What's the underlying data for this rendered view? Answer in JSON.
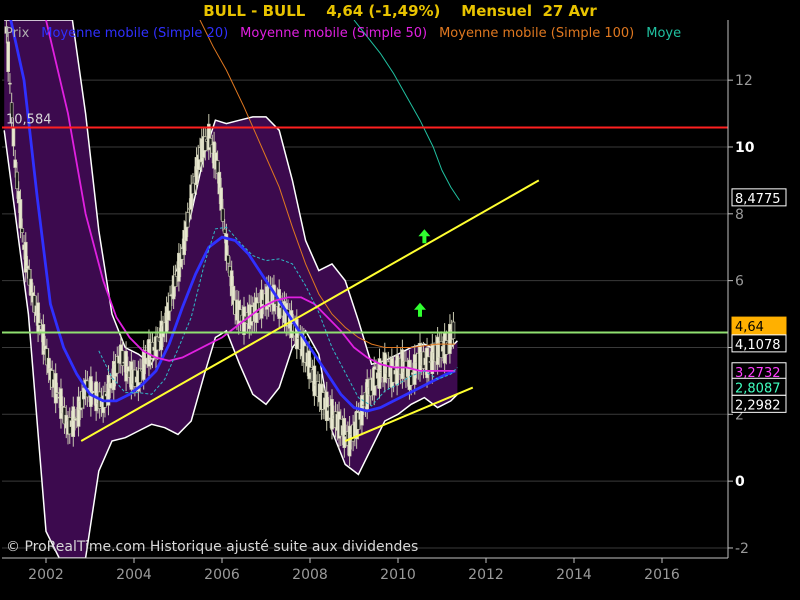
{
  "header": {
    "title": "BULL - BULL    4,64 (-1,49%)    Mensuel  27 Avr"
  },
  "legend": [
    {
      "label": "Prix",
      "color": "#b0b0b0"
    },
    {
      "label": "Moyenne mobile (Simple 20)",
      "color": "#3030ff"
    },
    {
      "label": "Moyenne mobile (Simple 50)",
      "color": "#e020e0"
    },
    {
      "label": "Moyenne mobile (Simple 100)",
      "color": "#e07820"
    },
    {
      "label": "Moye",
      "color": "#20c0a0"
    }
  ],
  "copyright": "© ProRealTime.com Historique ajusté suite aux dividendes",
  "chart_data": {
    "type": "line",
    "xlim": [
      2001,
      2017.5
    ],
    "ylim": [
      -2.3,
      13.8
    ],
    "x_ticks": [
      "2002",
      "2004",
      "2006",
      "2008",
      "2010",
      "2012",
      "2014",
      "2016"
    ],
    "y_ticks": [
      {
        "value": -2,
        "label": "-2",
        "strong": false
      },
      {
        "value": 0,
        "label": "0",
        "strong": true
      },
      {
        "value": 2,
        "label": "2",
        "strong": false
      },
      {
        "value": 4,
        "label": "4",
        "strong": false
      },
      {
        "value": 6,
        "label": "6",
        "strong": false
      },
      {
        "value": 8,
        "label": "8",
        "strong": false
      },
      {
        "value": 10,
        "label": "10",
        "strong": true
      },
      {
        "value": 12,
        "label": "12",
        "strong": false
      }
    ],
    "horizontal_lines": [
      {
        "name": "resistance-10-584",
        "value": 10.584,
        "label": "10,584",
        "color": "#ff2020"
      },
      {
        "name": "level-4-64",
        "value": 4.45,
        "label": "",
        "color": "#90e070"
      }
    ],
    "value_labels": [
      {
        "value": 8.4775,
        "label": "8,4775",
        "color": "#ffffff",
        "bg": "#000000",
        "border": "#ffffff"
      },
      {
        "value": 4.64,
        "label": "4,64",
        "color": "#000000",
        "bg": "#ffb000",
        "border": "#ffb000"
      },
      {
        "value": 4.1078,
        "label": "4,1078",
        "color": "#ffffff",
        "bg": "#000000",
        "border": "#ffffff"
      },
      {
        "value": 3.2732,
        "label": "3,2732",
        "color": "#ff40ff",
        "bg": "#000000",
        "border": "#ffffff"
      },
      {
        "value": 2.8087,
        "label": "2,8087",
        "color": "#40ffc0",
        "bg": "#000000",
        "border": "#ffffff"
      },
      {
        "value": 2.2982,
        "label": "2,2982",
        "color": "#ffffff",
        "bg": "#000000",
        "border": "#ffffff"
      }
    ],
    "trendlines": [
      {
        "name": "upper-trendline",
        "color": "#ffff30",
        "points": [
          [
            2002.8,
            1.2
          ],
          [
            2013.2,
            9.0
          ]
        ]
      },
      {
        "name": "lower-trendline",
        "color": "#ffff30",
        "points": [
          [
            2008.8,
            1.2
          ],
          [
            2011.7,
            2.8
          ]
        ]
      }
    ],
    "arrows": [
      {
        "x": 2010.5,
        "y": 5.1,
        "color": "#30ff30"
      },
      {
        "x": 2010.6,
        "y": 7.3,
        "color": "#30ff30"
      }
    ],
    "series": [
      {
        "name": "Prix",
        "color": "#d8d8c0",
        "x": [
          2001.1,
          2001.3,
          2001.5,
          2001.7,
          2001.9,
          2002.1,
          2002.3,
          2002.5,
          2002.7,
          2002.9,
          2003.1,
          2003.3,
          2003.5,
          2003.7,
          2003.9,
          2004.1,
          2004.3,
          2004.5,
          2004.7,
          2004.9,
          2005.1,
          2005.3,
          2005.5,
          2005.7,
          2005.9,
          2006.1,
          2006.3,
          2006.5,
          2006.7,
          2006.9,
          2007.1,
          2007.3,
          2007.5,
          2007.7,
          2007.9,
          2008.1,
          2008.3,
          2008.5,
          2008.7,
          2008.9,
          2009.1,
          2009.3,
          2009.5,
          2009.7,
          2009.9,
          2010.1,
          2010.3,
          2010.5,
          2010.7,
          2010.9,
          2011.1,
          2011.3
        ],
        "y": [
          13.5,
          9.5,
          7.0,
          5.5,
          4.5,
          3.2,
          2.5,
          1.6,
          1.9,
          2.8,
          2.6,
          2.3,
          3.0,
          3.8,
          3.2,
          3.0,
          3.8,
          4.0,
          4.6,
          5.8,
          6.8,
          8.5,
          9.8,
          10.3,
          9.4,
          7.0,
          5.2,
          4.8,
          5.0,
          5.3,
          5.6,
          5.3,
          4.9,
          4.4,
          3.8,
          3.0,
          2.4,
          2.0,
          1.6,
          1.2,
          1.8,
          2.6,
          3.1,
          3.4,
          3.2,
          3.5,
          3.1,
          3.7,
          3.5,
          3.9,
          4.0,
          4.64
        ]
      },
      {
        "name": "Moyenne mobile (Simple 20)",
        "color": "#3030ff",
        "x": [
          2001.2,
          2001.5,
          2001.8,
          2002.1,
          2002.4,
          2002.7,
          2003.0,
          2003.3,
          2003.6,
          2003.9,
          2004.2,
          2004.5,
          2004.8,
          2005.1,
          2005.4,
          2005.7,
          2006.0,
          2006.3,
          2006.6,
          2006.9,
          2007.2,
          2007.5,
          2007.8,
          2008.1,
          2008.4,
          2008.7,
          2009.0,
          2009.3,
          2009.6,
          2009.9,
          2010.2,
          2010.5,
          2010.8,
          2011.1,
          2011.3
        ],
        "y": [
          13.8,
          12.0,
          8.5,
          5.3,
          4.0,
          3.2,
          2.6,
          2.4,
          2.4,
          2.6,
          2.9,
          3.3,
          4.1,
          5.2,
          6.2,
          7.0,
          7.3,
          7.2,
          6.8,
          6.2,
          5.6,
          5.0,
          4.4,
          3.8,
          3.2,
          2.6,
          2.2,
          2.1,
          2.2,
          2.4,
          2.6,
          2.8,
          3.0,
          3.2,
          3.3
        ]
      },
      {
        "name": "Moyenne mobile (Simple 50)",
        "color": "#e020e0",
        "x": [
          2002.0,
          2002.5,
          2002.9,
          2003.3,
          2003.6,
          2003.9,
          2004.2,
          2004.5,
          2004.8,
          2005.1,
          2005.4,
          2005.7,
          2006.0,
          2006.3,
          2006.6,
          2006.9,
          2007.2,
          2007.5,
          2007.8,
          2008.1,
          2008.4,
          2008.7,
          2009.0,
          2009.3,
          2009.6,
          2009.9,
          2010.2,
          2010.5,
          2010.8,
          2011.3
        ],
        "y": [
          13.8,
          11.0,
          8.0,
          6.0,
          4.9,
          4.3,
          3.9,
          3.7,
          3.6,
          3.7,
          3.9,
          4.1,
          4.3,
          4.6,
          4.9,
          5.2,
          5.4,
          5.5,
          5.5,
          5.3,
          4.9,
          4.5,
          4.0,
          3.7,
          3.5,
          3.4,
          3.4,
          3.3,
          3.3,
          3.3
        ]
      },
      {
        "name": "Moyenne mobile (Simple 100)",
        "color": "#e07820",
        "x": [
          2005.5,
          2005.8,
          2006.1,
          2006.5,
          2006.9,
          2007.3,
          2007.6,
          2007.9,
          2008.2,
          2008.5,
          2008.8,
          2009.1,
          2009.4,
          2009.7,
          2010.0,
          2010.3,
          2010.6,
          2010.9,
          2011.3
        ],
        "y": [
          13.8,
          13.0,
          12.3,
          11.2,
          10.0,
          8.8,
          7.6,
          6.5,
          5.6,
          5.0,
          4.6,
          4.3,
          4.1,
          4.0,
          4.0,
          4.0,
          4.05,
          4.1,
          4.1
        ]
      },
      {
        "name": "Moye",
        "color": "#20c0a0",
        "x": [
          2009.0,
          2009.3,
          2009.6,
          2009.9,
          2010.2,
          2010.5,
          2010.8,
          2011.0,
          2011.2,
          2011.4
        ],
        "y": [
          13.8,
          13.3,
          12.8,
          12.2,
          11.5,
          10.8,
          10.0,
          9.3,
          8.8,
          8.4
        ]
      }
    ],
    "bollinger_upper": {
      "x": [
        2001.05,
        2001.3,
        2001.6,
        2002.0,
        2002.3,
        2002.6,
        2002.9,
        2003.2,
        2003.5,
        2003.8,
        2004.1,
        2004.4,
        2004.7,
        2005.0,
        2005.3,
        2005.6,
        2005.85,
        2006.1,
        2006.4,
        2006.7,
        2007.0,
        2007.3,
        2007.6,
        2007.9,
        2008.2,
        2008.5,
        2008.8,
        2009.1,
        2009.4,
        2009.7,
        2010.0,
        2010.3,
        2010.6,
        2010.9,
        2011.2,
        2011.35
      ],
      "y": [
        13.8,
        13.8,
        13.8,
        13.8,
        13.8,
        13.8,
        11.0,
        7.5,
        5.0,
        4.0,
        3.8,
        3.5,
        4.5,
        6.5,
        8.0,
        9.8,
        10.8,
        10.7,
        10.8,
        10.9,
        10.9,
        10.5,
        9.0,
        7.2,
        6.3,
        6.5,
        6.0,
        4.8,
        3.5,
        3.6,
        3.8,
        4.0,
        4.1,
        3.9,
        4.0,
        4.2
      ]
    },
    "bollinger_lower": {
      "x": [
        2001.05,
        2001.3,
        2001.6,
        2002.0,
        2002.3,
        2002.6,
        2002.9,
        2003.2,
        2003.5,
        2003.8,
        2004.1,
        2004.4,
        2004.7,
        2005.0,
        2005.3,
        2005.6,
        2005.85,
        2006.1,
        2006.4,
        2006.7,
        2007.0,
        2007.3,
        2007.6,
        2007.9,
        2008.2,
        2008.5,
        2008.8,
        2009.1,
        2009.4,
        2009.7,
        2010.0,
        2010.3,
        2010.6,
        2010.9,
        2011.2,
        2011.35
      ],
      "y": [
        10.5,
        8.0,
        5.0,
        -1.5,
        -2.3,
        -2.3,
        -2.3,
        0.3,
        1.2,
        1.3,
        1.5,
        1.7,
        1.6,
        1.4,
        1.8,
        3.2,
        4.3,
        4.5,
        3.5,
        2.6,
        2.3,
        2.8,
        4.0,
        4.5,
        3.8,
        1.5,
        0.5,
        0.2,
        1.0,
        1.8,
        2.0,
        2.3,
        2.5,
        2.2,
        2.4,
        2.6
      ]
    }
  }
}
